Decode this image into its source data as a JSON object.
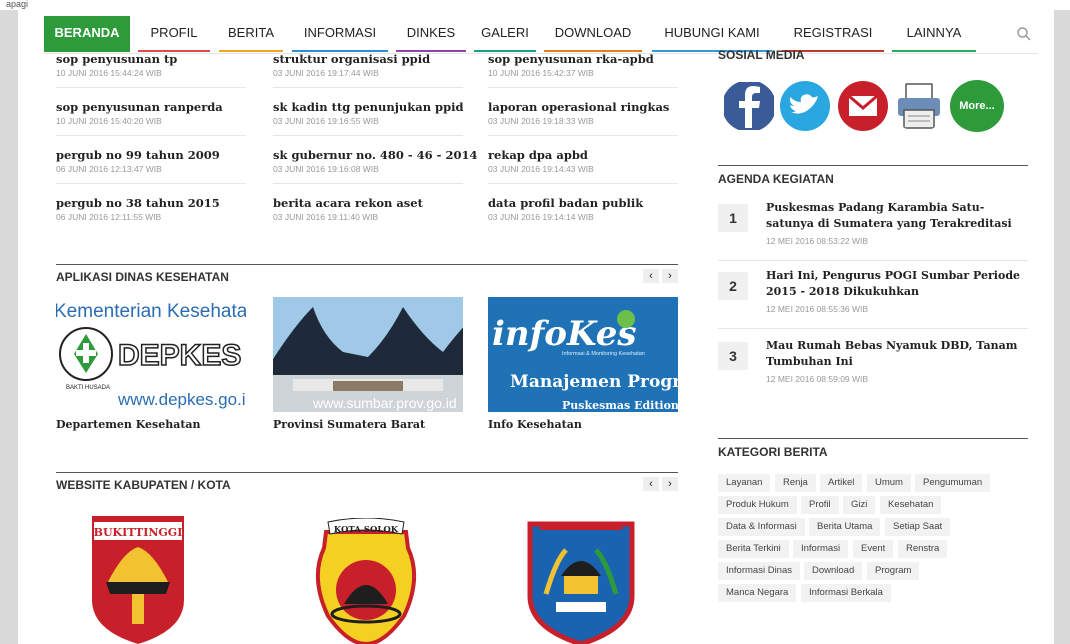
{
  "top_strip": "apagi",
  "nav": {
    "items": [
      "BERANDA",
      "PROFIL",
      "BERITA",
      "INFORMASI",
      "DINKES",
      "GALERI",
      "DOWNLOAD",
      "HUBUNGI KAMI",
      "REGISTRASI",
      "LAINNYA"
    ],
    "active_index": 0,
    "accent": "#2e9b3b",
    "bar_colors": [
      "#2e9b3b",
      "#e14b4b",
      "#f0a52a",
      "#2a8fd6",
      "#8e44ad",
      "#16a085",
      "#e67e22",
      "#3498db",
      "#c0392b",
      "#27ae60"
    ]
  },
  "posts": [
    {
      "title": "sop penyusunan tp",
      "date": "10 JUNI 2016 15:44:24 WIB"
    },
    {
      "title": "struktur organisasi ppid",
      "date": "03 JUNI 2016 19:17:44 WIB"
    },
    {
      "title": "sop penyusunan rka-apbd",
      "date": "10 JUNI 2016 15:42:37 WIB"
    },
    {
      "title": "sop penyusunan ranperda",
      "date": "10 JUNI 2016 15:40:20 WIB"
    },
    {
      "title": "sk kadin ttg penunjukan ppid",
      "date": "03 JUNI 2016 19:16:55 WIB"
    },
    {
      "title": "laporan operasional ringkas",
      "date": "03 JUNI 2016 19:18:33 WIB"
    },
    {
      "title": "pergub no 99 tahun 2009",
      "date": "06 JUNI 2016 12:13:47 WIB"
    },
    {
      "title": "sk gubernur no. 480 - 46 - 2014",
      "date": "03 JUNI 2016 19:16:08 WIB"
    },
    {
      "title": "rekap dpa apbd",
      "date": "03 JUNI 2016 19:14:43 WIB"
    },
    {
      "title": "pergub no 38 tahun 2015",
      "date": "06 JUNI 2016 12:11:55 WIB"
    },
    {
      "title": "berita acara rekon aset",
      "date": "03 JUNI 2016 19:11:40 WIB"
    },
    {
      "title": "data profil badan publik",
      "date": "03 JUNI 2016 19:14:14 WIB"
    }
  ],
  "apps": {
    "heading": "APLIKASI DINAS KESEHATAN",
    "prev": "‹",
    "next": "›",
    "items": [
      {
        "caption": "Departemen Kesehatan",
        "img_top": "Kementerian Kesehatan R",
        "img_big": "DEPKES",
        "img_url": "www.depkes.go.id",
        "logo_ring": "BAKTI HUSADA"
      },
      {
        "caption": "Provinsi Sumatera Barat",
        "img_url": "www.sumbar.prov.go.id"
      },
      {
        "caption": "Info Kesehatan",
        "img_brand": "infoKes",
        "img_brand_sub": "Informasi & Monitoring Kesehatan",
        "img_title": "Manajemen Program",
        "img_sub": "Puskesmas Edition"
      }
    ]
  },
  "websites": {
    "heading": "WEBSITE KABUPATEN / KOTA",
    "prev": "‹",
    "next": "›",
    "items": [
      {
        "label": "BUKITTINGGI",
        "name": "bukittinggi"
      },
      {
        "label": "KOTA SOLOK",
        "name": "solok"
      },
      {
        "label": "",
        "name": "padang-panjang"
      }
    ]
  },
  "social": {
    "heading": "SOSIAL MEDIA",
    "more": "More..."
  },
  "agenda": {
    "heading": "AGENDA KEGIATAN",
    "items": [
      {
        "num": "1",
        "title": "Puskesmas Padang Karambia Satu-satunya di Sumatera yang Terakreditasi",
        "date": "12 MEI 2016 08:53:22 WIB"
      },
      {
        "num": "2",
        "title": "Hari Ini, Pengurus POGI Sumbar Periode 2015 - 2018 Dikukuhkan",
        "date": "12 MEI 2016 08:55:36 WIB"
      },
      {
        "num": "3",
        "title": "Mau Rumah Bebas Nyamuk DBD, Tanam Tumbuhan Ini",
        "date": "12 MEI 2016 08:59:09 WIB"
      }
    ]
  },
  "categories": {
    "heading": "KATEGORI BERITA",
    "rows": [
      [
        "Layanan",
        "Renja",
        "Artikel",
        "Umum",
        "Pengumuman"
      ],
      [
        "Produk Hukum",
        "Profil",
        "Gizi",
        "Kesehatan"
      ],
      [
        "Data & Informasi",
        "Berita Utama",
        "Setiap Saat"
      ],
      [
        "Berita Terkini",
        "Informasi",
        "Event",
        "Renstra"
      ],
      [
        "Informasi Dinas",
        "Download",
        "Program"
      ],
      [
        "Manca Negara",
        "Informasi Berkala"
      ]
    ]
  }
}
